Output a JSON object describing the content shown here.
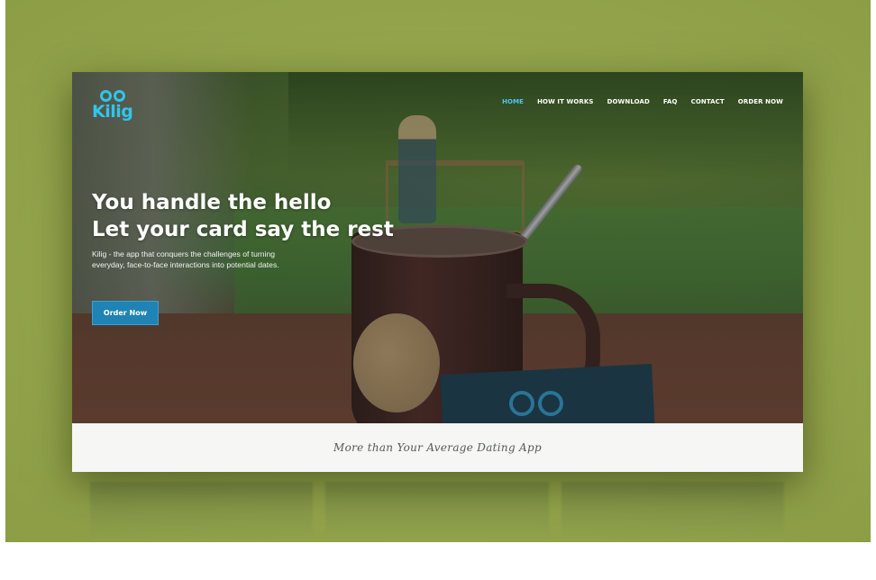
{
  "brand": {
    "logo_text": "Kilig",
    "logo_color": "#2fc6ee"
  },
  "nav": {
    "items": [
      {
        "label": "HOME",
        "active": true
      },
      {
        "label": "HOW IT WORKS",
        "active": false
      },
      {
        "label": "DOWNLOAD",
        "active": false
      },
      {
        "label": "FAQ",
        "active": false
      },
      {
        "label": "CONTACT",
        "active": false
      },
      {
        "label": "ORDER NOW",
        "active": false
      }
    ],
    "active_color": "#4cc7ee"
  },
  "hero": {
    "headline_line1": "You handle the hello",
    "headline_line2": "Let your card say the rest",
    "subtext_line1": "Kilig - the app that conquers the challenges of turning",
    "subtext_line2": "everyday, face-to-face interactions into potential dates.",
    "cta_label": "Order Now",
    "cta_color": "#1f83b5"
  },
  "tagline": {
    "text": "More than Your Average Dating App"
  },
  "colors": {
    "backdrop": "#93a44c"
  }
}
